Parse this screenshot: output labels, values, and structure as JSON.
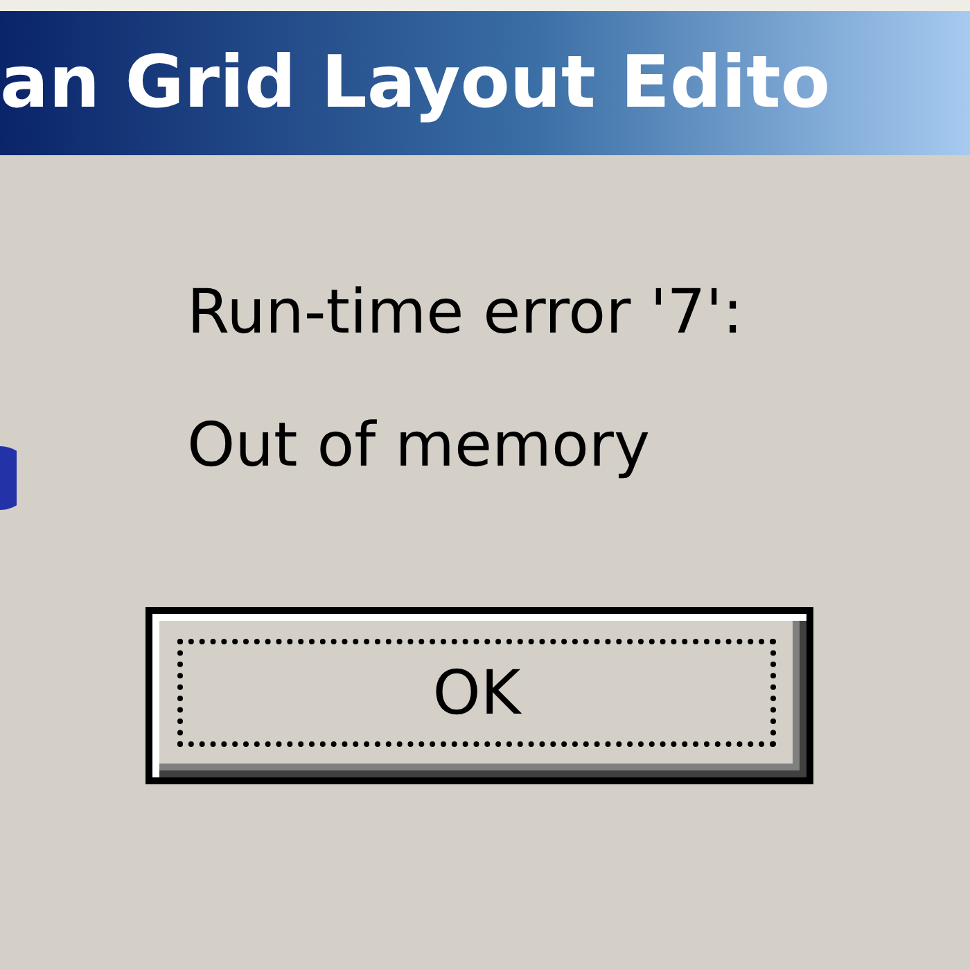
{
  "window": {
    "title": "an Grid Layout Edito"
  },
  "message": {
    "lines": [
      "Run-time error '7':",
      "Out of memory"
    ]
  },
  "buttons": [
    {
      "label": "OK",
      "focused": true
    }
  ]
}
